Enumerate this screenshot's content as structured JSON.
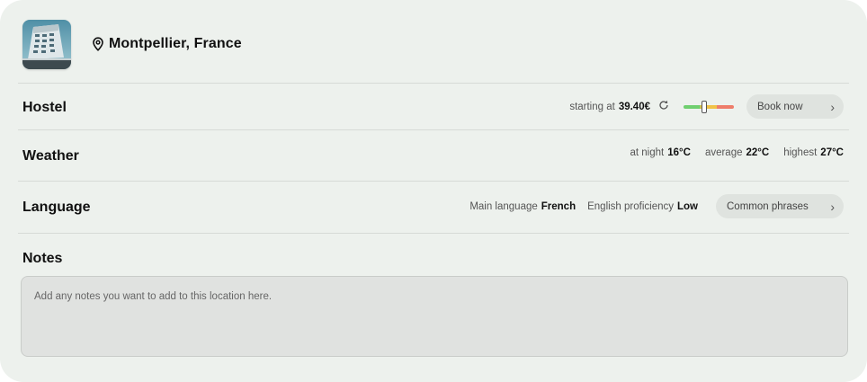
{
  "location": {
    "name": "Montpellier, France",
    "pin_icon": "map-pin-icon",
    "thumbnail_icon": "building-photo"
  },
  "hostel": {
    "title": "Hostel",
    "price_prefix": "starting at",
    "price": "39.40€",
    "refresh_icon": "refresh-icon",
    "price_gauge_level": 0.4,
    "book_label": "Book now",
    "book_chevron": "›"
  },
  "weather": {
    "title": "Weather",
    "night_label": "at night",
    "night_value": "16°C",
    "average_label": "average",
    "average_value": "22°C",
    "highest_label": "highest",
    "highest_value": "27°C"
  },
  "language": {
    "title": "Language",
    "main_label": "Main language",
    "main_value": "French",
    "english_label": "English proficiency",
    "english_value": "Low",
    "phrases_label": "Common phrases",
    "phrases_chevron": "›"
  },
  "notes": {
    "title": "Notes",
    "placeholder": "Add any notes you want to add to this location here."
  },
  "colors": {
    "card_bg": "#edf1ed",
    "pill_bg": "#dfe3df",
    "gauge_green": "#6fcf6f",
    "gauge_yellow": "#f0c247",
    "gauge_red": "#ee7d6a"
  }
}
